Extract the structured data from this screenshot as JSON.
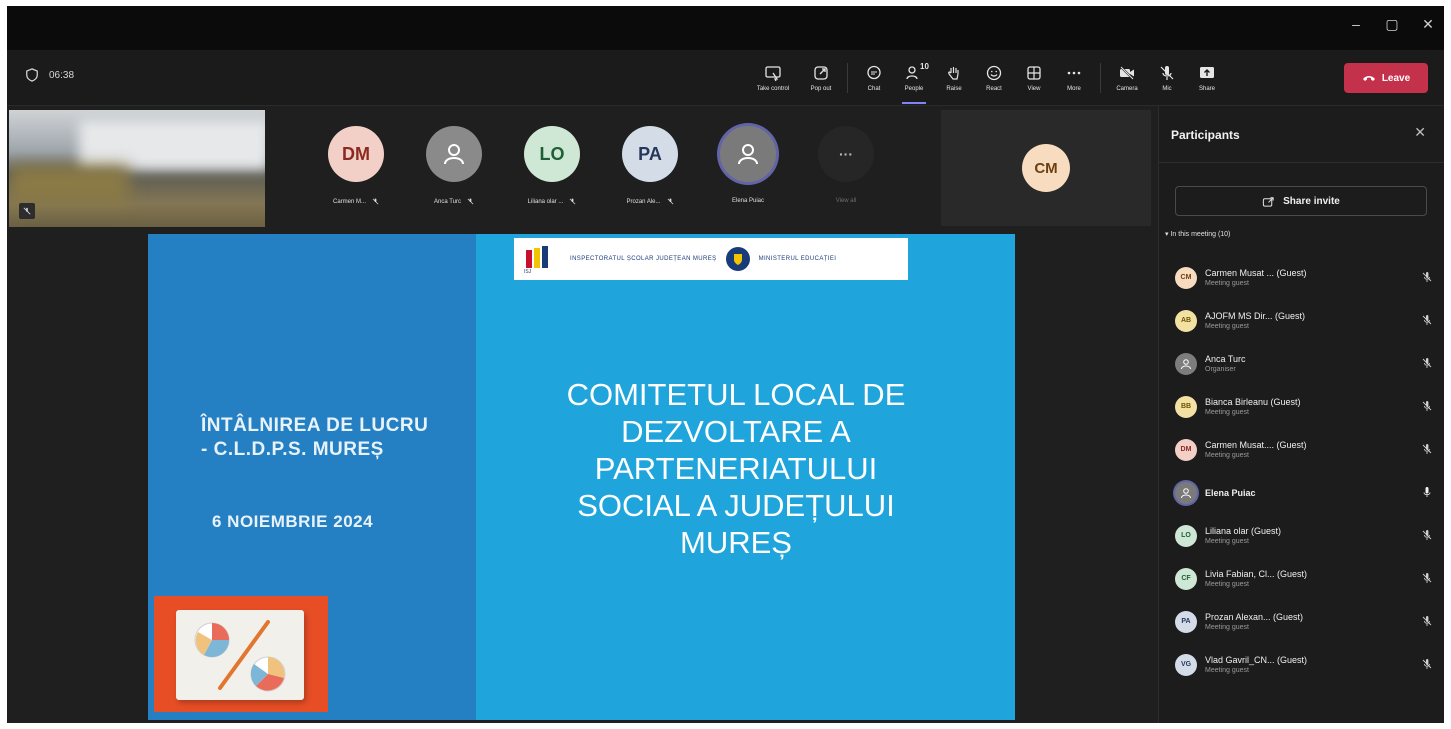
{
  "window": {
    "minimize": "–",
    "maximize": "▢",
    "close": "✕"
  },
  "meeting": {
    "elapsed": "06:38"
  },
  "toolbar": {
    "take_control": "Take control",
    "pop_out": "Pop out",
    "chat": "Chat",
    "people": "People",
    "people_count": "10",
    "raise": "Raise",
    "react": "React",
    "view": "View",
    "more": "More",
    "camera": "Camera",
    "mic": "Mic",
    "share": "Share",
    "leave": "Leave"
  },
  "gallery": {
    "tiles": [
      {
        "initials": "DM",
        "name": "Carmen M...",
        "bg": "#f2d0c8",
        "fg": "#8a2b22"
      },
      {
        "initials": "",
        "name": "Anca Turc",
        "bg": "#8a8a8a",
        "fg": "#ffffff"
      },
      {
        "initials": "LO",
        "name": "Liliana olar ...",
        "bg": "#cfe8d6",
        "fg": "#1f5f36"
      },
      {
        "initials": "PA",
        "name": "Prozan Ale...",
        "bg": "#d4dce8",
        "fg": "#27375c"
      },
      {
        "initials": "",
        "name": "Elena Puiac",
        "bg": "#7a7a7a",
        "fg": "#ffffff"
      },
      {
        "initials": "···",
        "name": "View all",
        "bg": "#262626",
        "fg": "#bdbdbd"
      }
    ],
    "featured": {
      "initials": "CM",
      "bg": "#f7dcc0",
      "fg": "#6b4012"
    }
  },
  "slide": {
    "logo_left": "INSPECTORATUL ȘCOLAR JUDEȚEAN MUREȘ",
    "logo_right": "MINISTERUL EDUCAȚIEI",
    "subtitle_line1": "ÎNTÂLNIREA DE LUCRU",
    "subtitle_line2": "- C.L.D.P.S. MUREȘ",
    "date": "6 NOIEMBRIE 2024",
    "title_lines": [
      "COMITETUL LOCAL DE",
      "DEZVOLTARE A",
      "PARTENERIATULUI",
      "SOCIAL A JUDEȚULUI",
      "MUREȘ"
    ]
  },
  "panel": {
    "title": "Participants",
    "close": "✕",
    "share_invite": "Share invite",
    "section": "In this meeting (10)",
    "participants": [
      {
        "initials": "CM",
        "name": "Carmen Musat ... (Guest)",
        "role": "Meeting guest",
        "bg": "#f7dcc0",
        "fg": "#6b4012",
        "muted": true
      },
      {
        "initials": "AB",
        "name": "AJOFM MS Dir... (Guest)",
        "role": "Meeting guest",
        "bg": "#f3e1a4",
        "fg": "#6b5200",
        "muted": true
      },
      {
        "initials": "",
        "name": "Anca Turc",
        "role": "Organiser",
        "bg": "#7d7d7d",
        "fg": "#ffffff",
        "muted": true
      },
      {
        "initials": "BB",
        "name": "Bianca Birleanu (Guest)",
        "role": "Meeting guest",
        "bg": "#f3e1a4",
        "fg": "#6b5200",
        "muted": true
      },
      {
        "initials": "DM",
        "name": "Carmen Musat.... (Guest)",
        "role": "Meeting guest",
        "bg": "#f2d0c8",
        "fg": "#8a2b22",
        "muted": true
      },
      {
        "initials": "",
        "name": "Elena Puiac",
        "role": "",
        "bg": "#7a7a7a",
        "fg": "#ffffff",
        "muted": false
      },
      {
        "initials": "LO",
        "name": "Liliana olar (Guest)",
        "role": "Meeting guest",
        "bg": "#cfe8d6",
        "fg": "#1f5f36",
        "muted": true
      },
      {
        "initials": "CF",
        "name": "Livia Fabian, Cl... (Guest)",
        "role": "Meeting guest",
        "bg": "#cfe8d6",
        "fg": "#1f5f36",
        "muted": true
      },
      {
        "initials": "PA",
        "name": "Prozan Alexan... (Guest)",
        "role": "Meeting guest",
        "bg": "#d4dce8",
        "fg": "#27375c",
        "muted": true
      },
      {
        "initials": "VG",
        "name": "Vlad Gavril_CN... (Guest)",
        "role": "Meeting guest",
        "bg": "#d4dce8",
        "fg": "#27375c",
        "muted": true
      }
    ]
  },
  "colors": {
    "accent": "#7f85f5",
    "leave": "#c4314b",
    "slide_blue": "#1fa5dc",
    "slide_dark_blue": "#2580c3"
  }
}
